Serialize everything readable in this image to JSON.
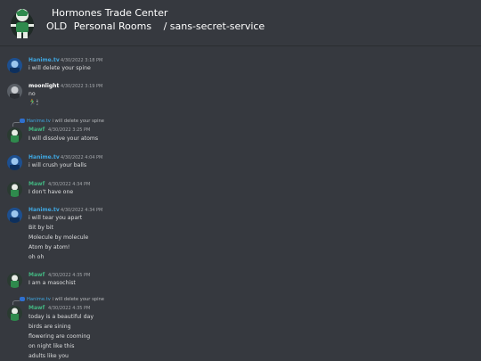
{
  "header": {
    "server_name": "Hormones Trade Center",
    "category": "OLD",
    "room": "Personal Rooms",
    "channel": "/ sans-secret-service"
  },
  "colors": {
    "hanime": "#3fa7e1",
    "moonlight": "#ffffff",
    "mawf": "#43b581",
    "background": "#36393f"
  },
  "messages": [
    {
      "author": "Hanime.tv",
      "timestamp": "4/30/2022 3:18 PM",
      "lines": [
        "i will delete your spine"
      ]
    },
    {
      "author": "moonlight",
      "timestamp": "4/30/2022 3:19 PM",
      "lines": [
        "no"
      ],
      "emoji": "🏃‍♂️🕯"
    },
    {
      "reply_to": {
        "author": "Hanime.tv",
        "text": "i will delete your spine"
      },
      "author": "Mawf",
      "timestamp": "4/30/2022 3:25 PM",
      "lines": [
        "I will dissolve your atoms"
      ]
    },
    {
      "author": "Hanime.tv",
      "timestamp": "4/30/2022 4:04 PM",
      "lines": [
        "i will crush your balls"
      ]
    },
    {
      "author": "Mawf",
      "timestamp": "4/30/2022 4:34 PM",
      "lines": [
        "I don't have one"
      ]
    },
    {
      "author": "Hanime.tv",
      "timestamp": "4/30/2022 4:34 PM",
      "lines": [
        "i will tear you apart",
        "Bit by bit",
        "Molecule by molecule",
        "Atom by atom!",
        "oh oh"
      ]
    },
    {
      "author": "Mawf",
      "timestamp": "4/30/2022 4:35 PM",
      "lines": [
        "I am a masochist"
      ]
    },
    {
      "reply_to": {
        "author": "Hanime.tv",
        "text": "i will delete your spine"
      },
      "author": "Mawf",
      "timestamp": "4/30/2022 4:35 PM",
      "lines": [
        "today is a beautiful day",
        "birds are sining",
        "flowering are cooming",
        "on night like this",
        "adults like you"
      ]
    }
  ]
}
